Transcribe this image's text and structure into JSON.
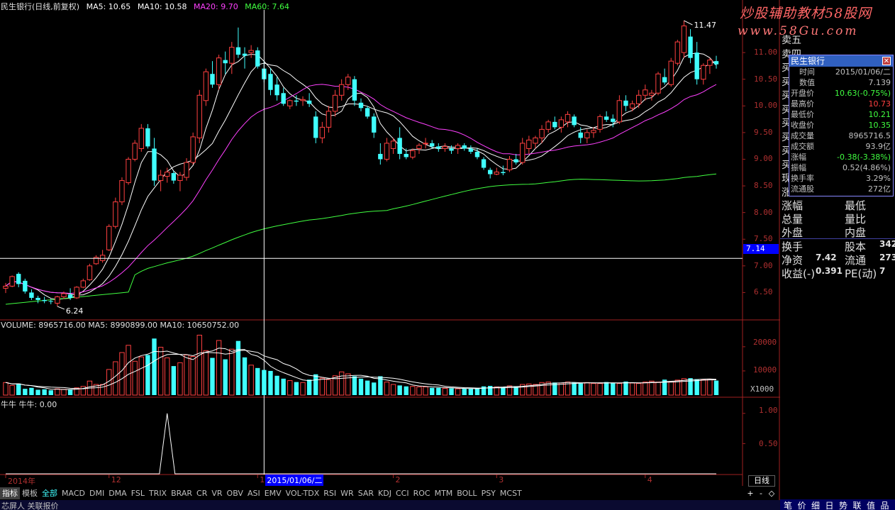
{
  "header": {
    "stock_name": "民生银行(日线,前复权)",
    "ma_items": [
      {
        "label": "MA5: 10.65",
        "color": "#ffffff"
      },
      {
        "label": "MA10: 10.58",
        "color": "#ffffff"
      },
      {
        "label": "MA20: 9.70",
        "color": "#ff40ff"
      },
      {
        "label": "MA60: 7.64",
        "color": "#40ff40"
      }
    ]
  },
  "watermark": {
    "line1": "炒股辅助教材58股网",
    "line2": "www.58Gu.com"
  },
  "chart_data": [
    {
      "type": "candlestick",
      "title": "民生银行(日线,前复权)",
      "ylim": [
        6.0,
        11.8
      ],
      "yticks": [
        "11.00",
        "10.50",
        "10.00",
        "9.50",
        "9.00",
        "8.50",
        "8.00",
        "7.50",
        "7.00",
        "6.50"
      ],
      "high_label": "11.47",
      "low_label": "6.24",
      "crosshair_price": "7.14",
      "ohlc": [
        [
          6.58,
          6.68,
          6.49,
          6.62
        ],
        [
          6.62,
          6.82,
          6.6,
          6.8
        ],
        [
          6.85,
          6.88,
          6.6,
          6.66
        ],
        [
          6.72,
          6.76,
          6.48,
          6.52
        ],
        [
          6.5,
          6.56,
          6.36,
          6.4
        ],
        [
          6.4,
          6.44,
          6.3,
          6.36
        ],
        [
          6.36,
          6.42,
          6.3,
          6.34
        ],
        [
          6.34,
          6.38,
          6.28,
          6.33
        ],
        [
          6.3,
          6.44,
          6.24,
          6.42
        ],
        [
          6.42,
          6.52,
          6.38,
          6.48
        ],
        [
          6.46,
          6.58,
          6.36,
          6.4
        ],
        [
          6.4,
          6.62,
          6.38,
          6.6
        ],
        [
          6.6,
          6.76,
          6.58,
          6.72
        ],
        [
          6.74,
          7.04,
          6.72,
          7.0
        ],
        [
          7.04,
          7.2,
          7.02,
          7.16
        ],
        [
          7.1,
          7.3,
          7.06,
          7.2
        ],
        [
          7.3,
          7.78,
          7.28,
          7.74
        ],
        [
          7.74,
          8.28,
          7.7,
          8.2
        ],
        [
          8.2,
          8.66,
          8.14,
          8.6
        ],
        [
          8.56,
          9.04,
          8.52,
          9.0
        ],
        [
          9.0,
          9.36,
          8.96,
          9.3
        ],
        [
          9.2,
          9.66,
          9.14,
          9.58
        ],
        [
          9.58,
          9.66,
          9.2,
          9.24
        ],
        [
          9.2,
          9.4,
          8.5,
          8.6
        ],
        [
          8.6,
          8.8,
          8.4,
          8.7
        ],
        [
          8.68,
          8.84,
          8.56,
          8.76
        ],
        [
          8.74,
          8.78,
          8.54,
          8.6
        ],
        [
          8.6,
          8.76,
          8.4,
          8.7
        ],
        [
          8.66,
          9.02,
          8.6,
          8.94
        ],
        [
          8.94,
          9.5,
          8.9,
          9.42
        ],
        [
          9.4,
          10.3,
          9.3,
          10.2
        ],
        [
          10.1,
          10.7,
          10.0,
          10.64
        ],
        [
          10.6,
          10.84,
          10.34,
          10.4
        ],
        [
          10.4,
          10.96,
          10.3,
          10.9
        ],
        [
          10.86,
          11.02,
          10.6,
          10.8
        ],
        [
          10.8,
          11.2,
          10.6,
          11.1
        ],
        [
          11.1,
          11.47,
          10.9,
          10.96
        ],
        [
          10.98,
          11.1,
          10.7,
          10.94
        ],
        [
          11.0,
          11.14,
          10.9,
          11.04
        ],
        [
          11.04,
          11.1,
          10.7,
          10.74
        ],
        [
          10.7,
          10.84,
          10.44,
          10.5
        ],
        [
          10.6,
          10.7,
          10.2,
          10.3
        ],
        [
          10.4,
          10.54,
          10.1,
          10.2
        ],
        [
          10.24,
          10.34,
          10.0,
          10.04
        ],
        [
          10.0,
          10.12,
          9.94,
          10.1
        ],
        [
          10.1,
          10.2,
          10.0,
          10.08
        ],
        [
          10.1,
          10.18,
          10.0,
          10.12
        ],
        [
          10.1,
          10.24,
          9.98,
          10.04
        ],
        [
          9.8,
          9.9,
          9.3,
          9.4
        ],
        [
          9.4,
          9.7,
          9.3,
          9.6
        ],
        [
          9.6,
          10.0,
          9.5,
          9.9
        ],
        [
          9.9,
          10.3,
          9.8,
          10.2
        ],
        [
          10.2,
          10.5,
          10.1,
          10.4
        ],
        [
          10.4,
          10.6,
          10.3,
          10.54
        ],
        [
          10.5,
          10.56,
          10.0,
          10.1
        ],
        [
          10.06,
          10.14,
          9.9,
          9.96
        ],
        [
          9.96,
          10.0,
          9.76,
          9.8
        ],
        [
          9.8,
          9.86,
          9.4,
          9.5
        ],
        [
          9.1,
          9.3,
          8.9,
          9.0
        ],
        [
          9.0,
          9.4,
          8.96,
          9.3
        ],
        [
          9.2,
          9.4,
          9.1,
          9.34
        ],
        [
          9.4,
          9.6,
          9.0,
          9.1
        ],
        [
          9.1,
          9.2,
          9.0,
          9.04
        ],
        [
          9.04,
          9.2,
          9.0,
          9.16
        ],
        [
          9.2,
          9.3,
          9.1,
          9.26
        ],
        [
          9.3,
          9.4,
          9.2,
          9.3
        ],
        [
          9.3,
          9.36,
          9.2,
          9.24
        ],
        [
          9.24,
          9.3,
          9.14,
          9.2
        ],
        [
          9.2,
          9.3,
          9.14,
          9.24
        ],
        [
          9.2,
          9.26,
          9.1,
          9.16
        ],
        [
          9.2,
          9.3,
          9.1,
          9.26
        ],
        [
          9.26,
          9.3,
          9.16,
          9.2
        ],
        [
          9.2,
          9.26,
          9.1,
          9.14
        ],
        [
          9.14,
          9.2,
          9.0,
          9.04
        ],
        [
          9.0,
          9.04,
          8.8,
          8.84
        ],
        [
          8.8,
          8.84,
          8.64,
          8.72
        ],
        [
          8.72,
          8.84,
          8.7,
          8.76
        ],
        [
          8.76,
          8.88,
          8.7,
          8.74
        ],
        [
          8.8,
          9.06,
          8.76,
          9.0
        ],
        [
          9.0,
          9.1,
          8.9,
          8.94
        ],
        [
          8.94,
          9.4,
          8.9,
          9.3
        ],
        [
          9.2,
          9.44,
          9.1,
          9.36
        ],
        [
          9.3,
          9.44,
          9.2,
          9.4
        ],
        [
          9.4,
          9.64,
          9.3,
          9.56
        ],
        [
          9.56,
          9.74,
          9.5,
          9.7
        ],
        [
          9.7,
          9.8,
          9.56,
          9.6
        ],
        [
          9.6,
          9.8,
          9.5,
          9.74
        ],
        [
          9.7,
          9.9,
          9.6,
          9.84
        ],
        [
          9.8,
          9.84,
          9.6,
          9.64
        ],
        [
          9.5,
          9.6,
          9.3,
          9.4
        ],
        [
          9.4,
          9.56,
          9.3,
          9.5
        ],
        [
          9.5,
          9.6,
          9.4,
          9.54
        ],
        [
          9.56,
          9.84,
          9.5,
          9.8
        ],
        [
          9.8,
          9.9,
          9.7,
          9.74
        ],
        [
          9.76,
          9.84,
          9.6,
          9.7
        ],
        [
          9.7,
          10.2,
          9.66,
          10.1
        ],
        [
          10.1,
          10.2,
          9.9,
          10.0
        ],
        [
          9.96,
          10.1,
          9.9,
          10.04
        ],
        [
          10.04,
          10.3,
          9.96,
          10.2
        ],
        [
          10.2,
          10.4,
          10.1,
          10.3
        ],
        [
          10.2,
          10.3,
          10.1,
          10.24
        ],
        [
          10.24,
          10.64,
          10.2,
          10.6
        ],
        [
          10.54,
          10.7,
          10.4,
          10.44
        ],
        [
          10.4,
          10.9,
          10.36,
          10.84
        ],
        [
          10.8,
          11.24,
          10.76,
          11.2
        ],
        [
          11.0,
          11.6,
          10.9,
          11.5
        ],
        [
          11.3,
          11.44,
          10.8,
          10.9
        ],
        [
          11.0,
          11.2,
          10.4,
          10.5
        ],
        [
          10.5,
          10.8,
          10.4,
          10.76
        ],
        [
          10.76,
          10.9,
          10.6,
          10.86
        ],
        [
          10.84,
          10.94,
          10.7,
          10.78
        ]
      ],
      "series": [
        {
          "name": "MA5",
          "color": "#ffffff"
        },
        {
          "name": "MA10",
          "color": "#ffffff"
        },
        {
          "name": "MA20",
          "color": "#ff40ff"
        },
        {
          "name": "MA60",
          "color": "#40ff40"
        }
      ]
    },
    {
      "type": "bar",
      "title": "VOLUME: 8965716.00  MA5: 8990899.00  MA10: 10650752.00",
      "yticks": [
        "20000",
        "10000"
      ],
      "unit_label": "X1000",
      "ylim": [
        0,
        27000
      ],
      "values": [
        5200,
        4000,
        4800,
        2600,
        3000,
        2200,
        2400,
        2000,
        2600,
        2400,
        2200,
        3000,
        3600,
        5800,
        4400,
        4400,
        10600,
        13800,
        17600,
        20600,
        14000,
        15800,
        16600,
        23400,
        19800,
        15400,
        12000,
        13400,
        16600,
        16000,
        24800,
        18400,
        15400,
        22600,
        14800,
        19000,
        22400,
        15600,
        12400,
        11200,
        10400,
        10000,
        8000,
        6800,
        6000,
        5400,
        5200,
        6400,
        8600,
        7000,
        6400,
        8000,
        9600,
        8800,
        7800,
        6800,
        6000,
        5200,
        7800,
        5400,
        4400,
        4000,
        3600,
        3600,
        3400,
        3400,
        3000,
        3000,
        2800,
        2800,
        2600,
        2600,
        2600,
        2800,
        3600,
        3800,
        3400,
        3200,
        3800,
        3400,
        4400,
        4600,
        4400,
        5200,
        5400,
        5200,
        5000,
        5400,
        5200,
        4800,
        5200,
        4800,
        4800,
        5400,
        5000,
        4800,
        5600,
        5000,
        4800,
        5400,
        5800,
        5400,
        6400,
        5600,
        6200,
        6800,
        7000,
        6600,
        6400,
        6600,
        6000
      ]
    },
    {
      "type": "line",
      "title": "牛牛 牛牛: 0.00",
      "yticks": [
        "1.00",
        "0.50"
      ],
      "ylim": [
        0,
        1.15
      ],
      "values": [
        0,
        0,
        0,
        0,
        0,
        0,
        0,
        0,
        0,
        0,
        0,
        0,
        0,
        0,
        0,
        0,
        0,
        0,
        0,
        0,
        0,
        0,
        0,
        0,
        0,
        0,
        0,
        0,
        0,
        0,
        0,
        0,
        0,
        0,
        0,
        0,
        0,
        0,
        0,
        0,
        0,
        0,
        0,
        0,
        0,
        0,
        0,
        0,
        0,
        0,
        0,
        0,
        0,
        0,
        0,
        0,
        0,
        0,
        0,
        0,
        0,
        0,
        0,
        0,
        0,
        0,
        0,
        0,
        0,
        0,
        0,
        0,
        0,
        0,
        0,
        0,
        0,
        0,
        0,
        0,
        0,
        0,
        0,
        0,
        0,
        0,
        0,
        0,
        0,
        0,
        0,
        0,
        0,
        0,
        0,
        0,
        0,
        0,
        0,
        0,
        0,
        0,
        0,
        0,
        0,
        0,
        0,
        0,
        0,
        0,
        0
      ],
      "spike": {
        "index": 25,
        "value": 1.0
      },
      "xticks": [
        {
          "label": "2014年",
          "index": 0
        },
        {
          "label": "12",
          "index": 16
        },
        {
          "label": "1",
          "index": 39
        },
        {
          "label": "2",
          "index": 60
        },
        {
          "label": "3",
          "index": 76
        },
        {
          "label": "4",
          "index": 99
        }
      ],
      "crosshair_date": "2015/01/06/二"
    }
  ],
  "crosshair": {
    "index": 40
  },
  "info_box": {
    "title": "民生银行",
    "rows": [
      {
        "k": "时间",
        "v": "2015/01/06/二",
        "vc": "#c0c0c0"
      },
      {
        "k": "数值",
        "v": "7.139",
        "vc": "#c0c0c0"
      },
      {
        "k": "开盘价",
        "v": "10.63(-0.75%)",
        "vc": "#40ff40"
      },
      {
        "k": "最高价",
        "v": "10.73",
        "vc": "#ff4040"
      },
      {
        "k": "最低价",
        "v": "10.21",
        "vc": "#40ff40"
      },
      {
        "k": "收盘价",
        "v": "10.35",
        "vc": "#40ff40"
      },
      {
        "k": "成交量",
        "v": "8965716.5",
        "vc": "#c0c0c0"
      },
      {
        "k": "成交额",
        "v": "93.9亿",
        "vc": "#c0c0c0"
      },
      {
        "k": "涨幅",
        "v": "-0.38(-3.38%)",
        "vc": "#40ff40"
      },
      {
        "k": "振幅",
        "v": "0.52(4.86%)",
        "vc": "#c0c0c0"
      },
      {
        "k": "换手率",
        "v": "3.29%",
        "vc": "#c0c0c0"
      },
      {
        "k": "流通股",
        "v": "272亿",
        "vc": "#c0c0c0"
      }
    ]
  },
  "side_panel": {
    "partial_labels": [
      "卖五",
      "卖四",
      "买",
      "买",
      "买",
      "买",
      "买",
      "买",
      "买",
      "买",
      "现",
      "涨"
    ],
    "rows": [
      {
        "a": "涨幅",
        "b": "最低",
        "c": ""
      },
      {
        "a": "总量",
        "b": "量比",
        "c": ""
      },
      {
        "a": "外盘",
        "b": "内盘",
        "c": ""
      },
      {
        "a": "换手",
        "b": "股本",
        "c": "342"
      },
      {
        "a": "净资",
        "a2": "7.42",
        "b": "流通",
        "c": "273"
      },
      {
        "a": "收益(-)",
        "a2": "0.391",
        "b": "PE(动)",
        "c": "7"
      }
    ]
  },
  "tabs": {
    "items": [
      "指标",
      "模板",
      "全部",
      "MACD",
      "DMI",
      "DMA",
      "FSL",
      "TRIX",
      "BRAR",
      "CR",
      "VR",
      "OBV",
      "ASI",
      "EMV",
      "VOL-TDX",
      "RSI",
      "WR",
      "SAR",
      "KDJ",
      "CCI",
      "ROC",
      "MTM",
      "BOLL",
      "PSY",
      "MCST"
    ],
    "period": "日线",
    "plus": "+",
    "minus": "-",
    "more": "◇"
  },
  "bottom_right": [
    "笔",
    "价",
    "细",
    "日",
    "势",
    "联",
    "值",
    "品"
  ],
  "bottom_left": "芯屏人  关联报价"
}
